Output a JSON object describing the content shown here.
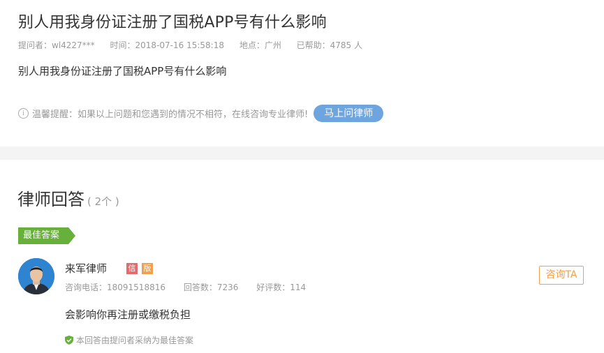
{
  "question": {
    "title": "别人用我身份证注册了国税APP号有什么影响",
    "asker": "提问者：wl4227***",
    "time": "时间：2018-07-16 15:58:18",
    "location": "地点：广州",
    "helped": "已帮助：4785 人",
    "body": "别人用我身份证注册了国税APP号有什么影响"
  },
  "tip": {
    "icon": "info-icon",
    "text": "温馨提醒：如果以上问题和您遇到的情况不相符，在线咨询专业律师!",
    "button": "马上问律师"
  },
  "answers_section": {
    "title": "律师回答",
    "count": "( 2个 )"
  },
  "best_answer": {
    "tag": "最佳答案",
    "lawyer_name": "来军律师",
    "badge_xin": "信",
    "badge_ban": "版",
    "phone": "咨询电话：18091518816",
    "answer_count": "回答数：7236",
    "good_count": "好评数：114",
    "consult_button": "咨询TA",
    "content": "会影响你再注册或缴税负担",
    "adopted_note": "本回答由提问者采纳为最佳答案"
  },
  "colors": {
    "accent_blue": "#6fa5df",
    "best_green": "#67b03c",
    "orange": "#f0a04b",
    "red_badge": "#e36b6b"
  }
}
